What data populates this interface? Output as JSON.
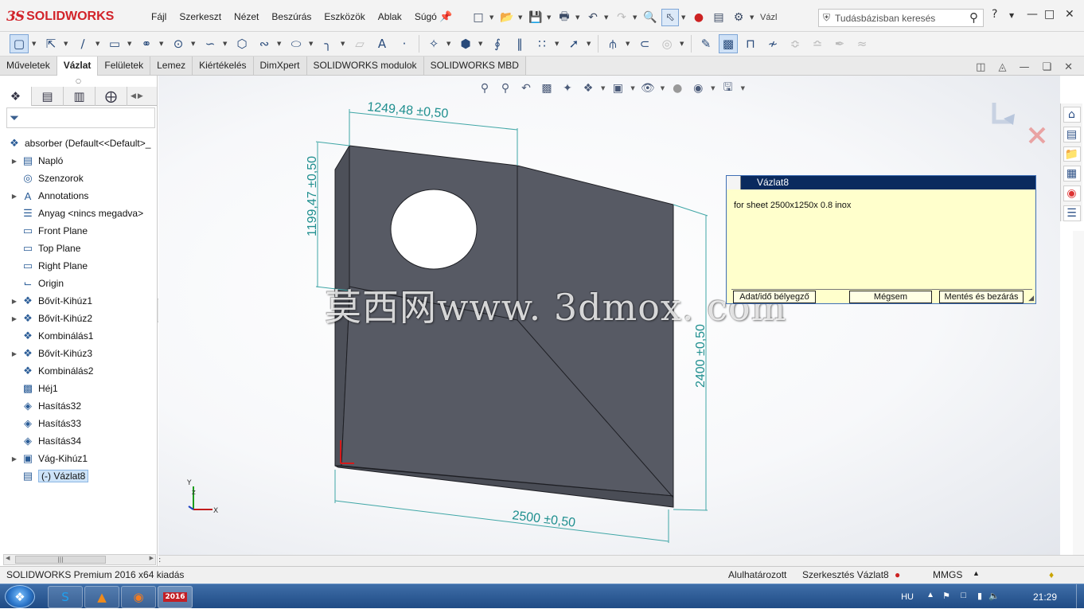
{
  "app": {
    "brand_ds": "3S",
    "brand_name": "SOLIDWORKS"
  },
  "menu": [
    "Fájl",
    "Szerkeszt",
    "Nézet",
    "Beszúrás",
    "Eszközök",
    "Ablak",
    "Súgó"
  ],
  "toolbar": {
    "vaz_label": "Vázl",
    "search_placeholder": "Tudásbázisban keresés",
    "help_label": "?"
  },
  "tabs": [
    "Műveletek",
    "Vázlat",
    "Felületek",
    "Lemez",
    "Kiértékelés",
    "DimXpert",
    "SOLIDWORKS modulok",
    "SOLIDWORKS MBD"
  ],
  "active_tab": "Vázlat",
  "tree": {
    "root": "absorber  (Default<<Default>_",
    "items": [
      {
        "label": "Napló",
        "expandable": true,
        "icon": "journal-icon"
      },
      {
        "label": "Szenzorok",
        "expandable": false,
        "icon": "sensor-icon"
      },
      {
        "label": "Annotations",
        "expandable": true,
        "icon": "annotation-icon"
      },
      {
        "label": "Anyag <nincs megadva>",
        "expandable": false,
        "icon": "material-icon"
      },
      {
        "label": "Front Plane",
        "expandable": false,
        "icon": "plane-icon"
      },
      {
        "label": "Top Plane",
        "expandable": false,
        "icon": "plane-icon"
      },
      {
        "label": "Right Plane",
        "expandable": false,
        "icon": "plane-icon"
      },
      {
        "label": "Origin",
        "expandable": false,
        "icon": "origin-icon"
      },
      {
        "label": "Bővít-Kihúz1",
        "expandable": true,
        "icon": "extrude-icon"
      },
      {
        "label": "Bővít-Kihúz2",
        "expandable": true,
        "icon": "extrude-icon"
      },
      {
        "label": "Kombinálás1",
        "expandable": false,
        "icon": "combine-icon"
      },
      {
        "label": "Bővít-Kihúz3",
        "expandable": true,
        "icon": "extrude-icon"
      },
      {
        "label": "Kombinálás2",
        "expandable": false,
        "icon": "combine-icon"
      },
      {
        "label": "Héj1",
        "expandable": false,
        "icon": "shell-icon"
      },
      {
        "label": "Hasítás32",
        "expandable": false,
        "icon": "split-icon"
      },
      {
        "label": "Hasítás33",
        "expandable": false,
        "icon": "split-icon"
      },
      {
        "label": "Hasítás34",
        "expandable": false,
        "icon": "split-icon"
      },
      {
        "label": "Vág-Kihúz1",
        "expandable": true,
        "icon": "cut-extrude-icon"
      },
      {
        "label": "(-) Vázlat8",
        "expandable": false,
        "icon": "sketch-icon",
        "selected": true
      }
    ]
  },
  "viewport": {
    "dimensions": [
      "1249,48 ±0,50",
      "1199,47 ±0,50",
      "2400 ±0,50",
      "2500 ±0,50"
    ],
    "axes": {
      "x": "X",
      "y": "Y",
      "z": "Z"
    },
    "watermark": "莫西网www. 3dmox. com"
  },
  "note": {
    "title": "Vázlat8",
    "body": "for sheet 2500x1250x 0.8 inox",
    "buttons": [
      "Adat/idő bélyegző",
      "Mégsem",
      "Mentés és bezárás"
    ]
  },
  "status": {
    "left": "SOLIDWORKS Premium 2016 x64 kiadás",
    "state": "Alulhatározott",
    "mode": "Szerkesztés Vázlat8",
    "units": "MMGS"
  },
  "taskbar": {
    "lang": "HU",
    "time": "21:29",
    "sw_badge": "2016"
  },
  "colors": {
    "part": "#575a64",
    "part_edge": "#1e1f24",
    "dimension": "#1f8f8f",
    "note_bg": "#ffffcc",
    "note_title": "#0a2a5e",
    "brand": "#d2232a"
  }
}
